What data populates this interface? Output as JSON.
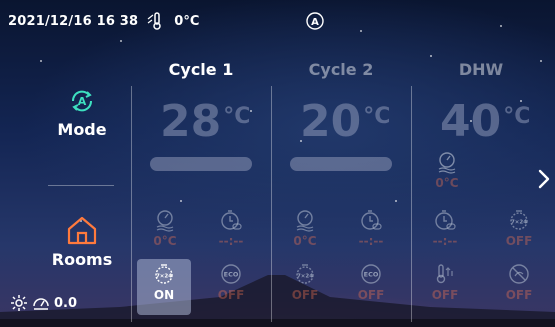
{
  "status": {
    "datetime": "2021/12/16 16 38",
    "outdoor_temp": "0°C",
    "thermo_icon": "outdoor-thermometer-icon",
    "auto_icon": "auto-mode-icon"
  },
  "left": {
    "mode_label": "Mode",
    "rooms_label": "Rooms",
    "bottom_value": "0.0"
  },
  "columns": [
    {
      "title": "Cycle 1",
      "temp": "28",
      "unit": "°C",
      "active": true
    },
    {
      "title": "Cycle 2",
      "temp": "20",
      "unit": "°C",
      "active": false
    },
    {
      "title": "DHW",
      "temp": "40",
      "unit": "°C",
      "active": false
    }
  ],
  "dhw_extra": {
    "value": "0°C"
  },
  "cells": {
    "c1_heat": "0°C",
    "c1_timer": "--:--",
    "c2_heat": "0°C",
    "c2_timer": "--:--",
    "dhw_timer": "--:--",
    "dhw_weekly": "OFF",
    "c1_weekly": "ON",
    "c1_eco": "OFF",
    "c2_weekly": "OFF",
    "c2_eco": "OFF",
    "dhw_boost": "OFF",
    "dhw_disinfect": "OFF"
  },
  "colors": {
    "accent": "#ff6a3d",
    "dim_text": "#8c96b4"
  }
}
